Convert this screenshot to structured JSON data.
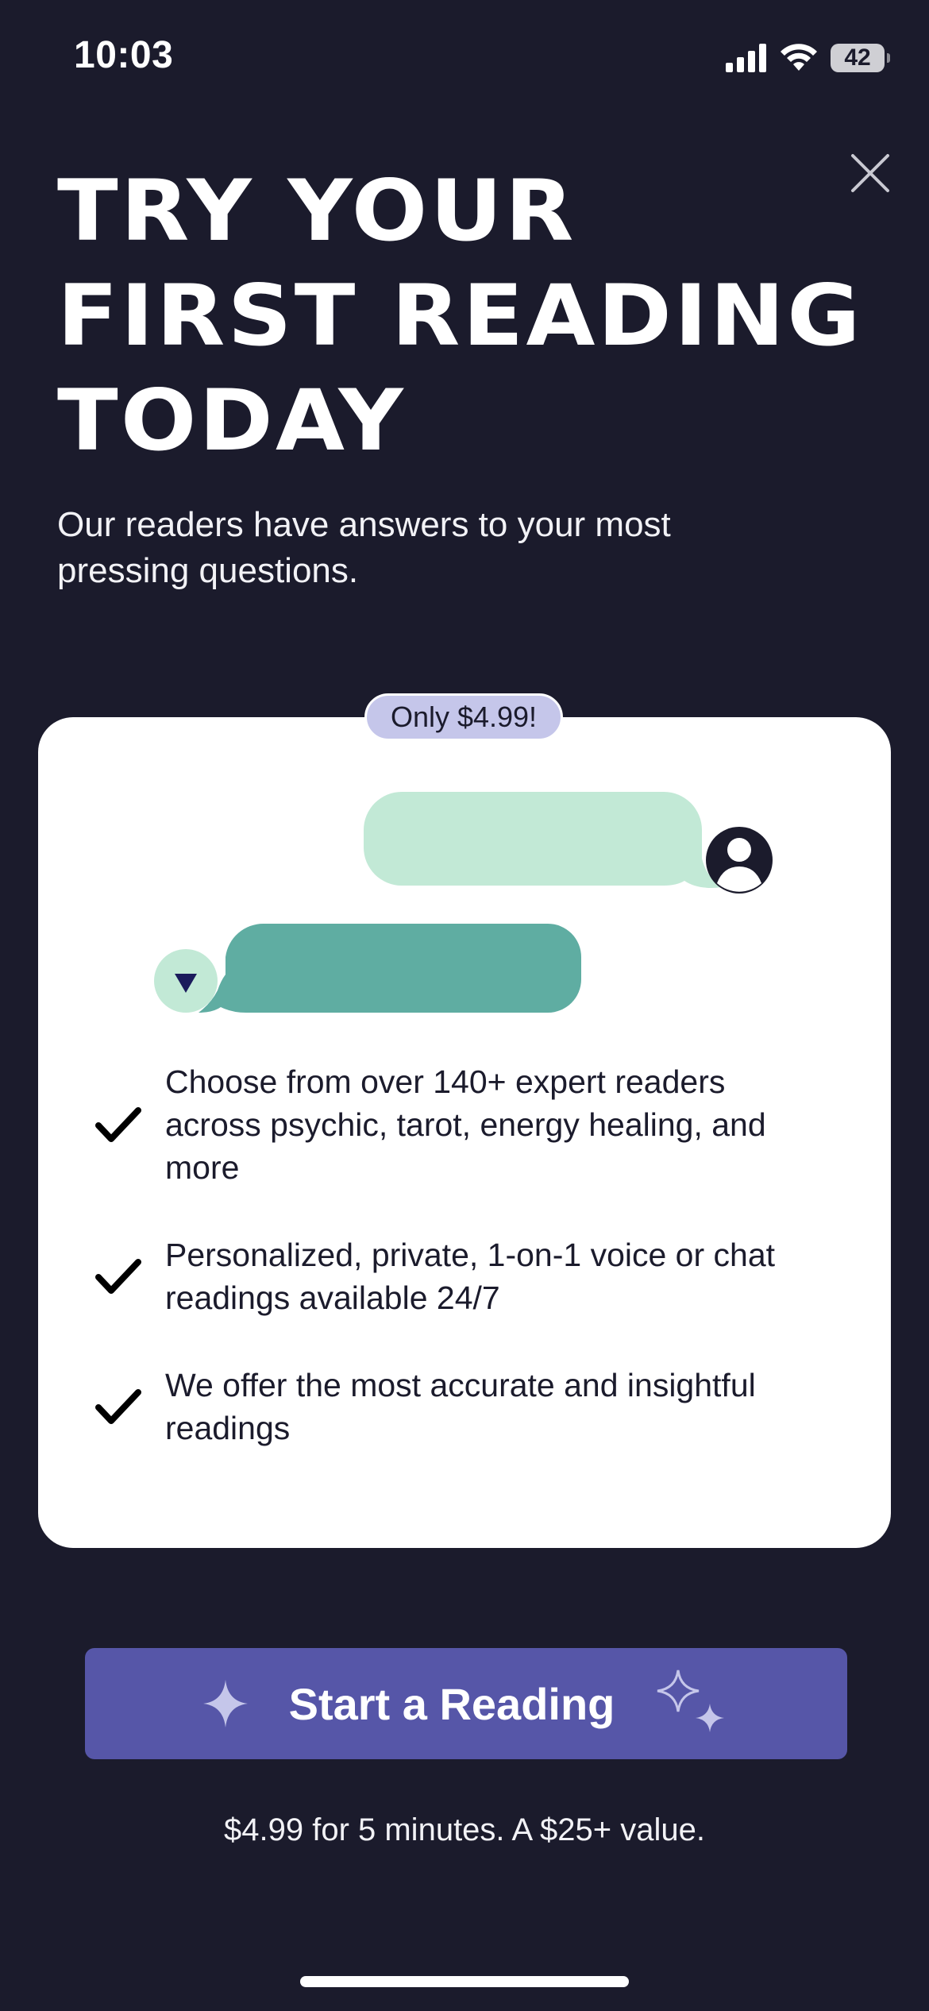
{
  "status_bar": {
    "time": "10:03",
    "battery_level": "42"
  },
  "headline": {
    "line1": "TRY YOUR",
    "line2": "FIRST READING",
    "line3": "TODAY"
  },
  "subtitle": "Our readers have answers to your most pressing questions.",
  "card": {
    "price_badge": "Only $4.99!",
    "features": [
      "Choose from over 140+ expert readers across psychic, tarot, energy healing, and more",
      "Personalized, private, 1-on-1 voice or chat readings available 24/7",
      "We offer the most accurate and insightful readings"
    ]
  },
  "cta": {
    "label": "Start a Reading",
    "note": "$4.99 for 5 minutes. A $25+ value."
  },
  "icons": {
    "close": "close-icon",
    "check": "check-icon",
    "sparkle": "sparkle-icon",
    "avatar": "user-avatar-icon"
  },
  "colors": {
    "background": "#1b1b2c",
    "card": "#ffffff",
    "badge": "#c5c6ea",
    "bubble_light": "#c2e9d6",
    "bubble_dark": "#5fada2",
    "cta": "#5656a8"
  }
}
